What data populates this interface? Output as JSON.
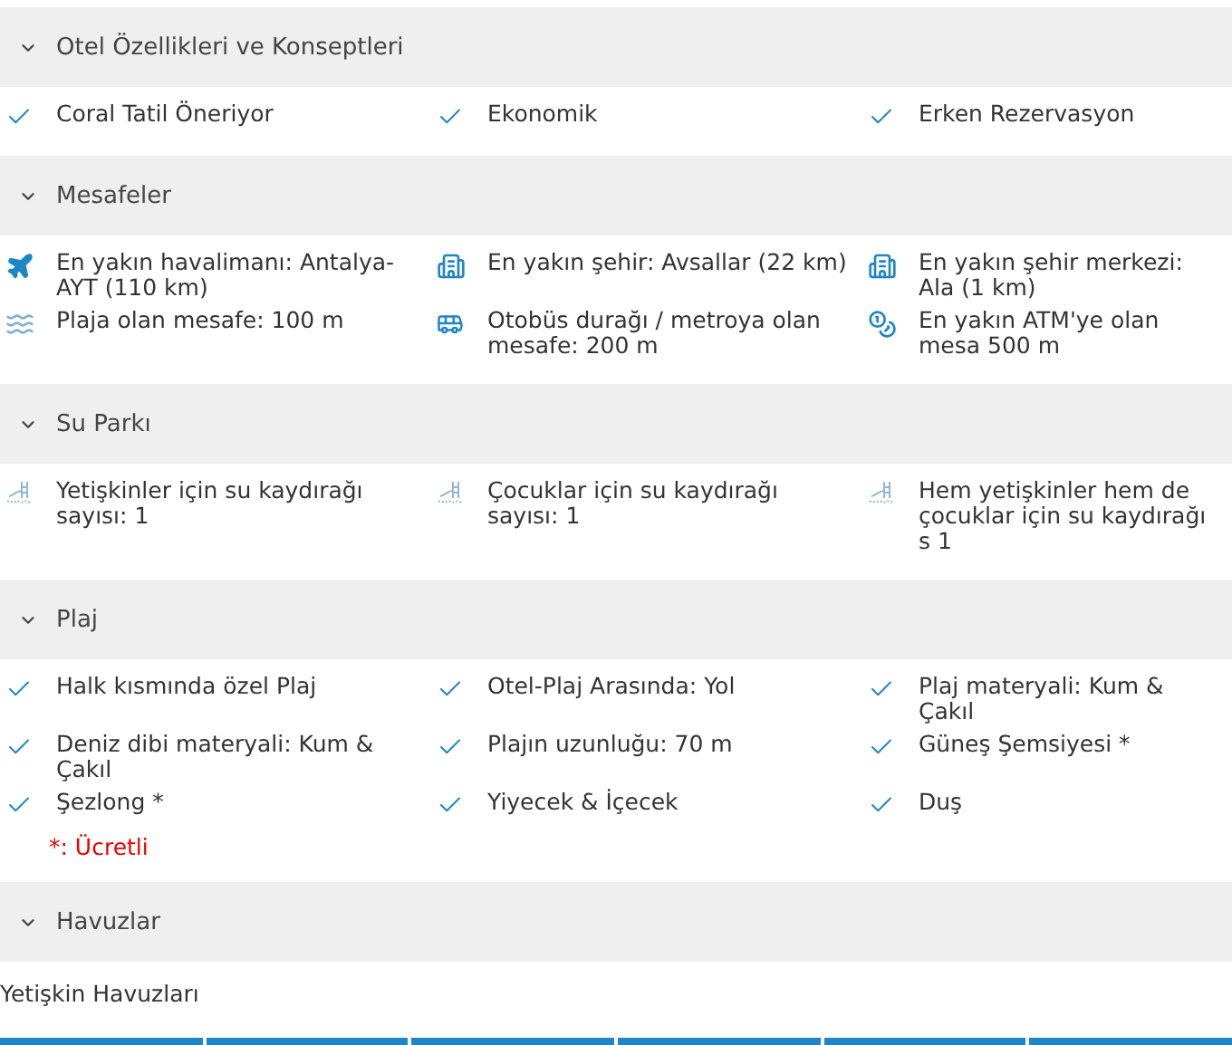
{
  "sections": [
    {
      "title": "Otel Özellikleri ve Konseptleri",
      "expanded": true,
      "items": [
        {
          "kind": "check",
          "text": "Coral Tatil Öneriyor"
        },
        {
          "kind": "check",
          "text": "Ekonomik"
        },
        {
          "kind": "check",
          "text": "Erken Rezervasyon"
        }
      ]
    },
    {
      "title": "Mesafeler",
      "expanded": true,
      "items": [
        {
          "kind": "plane",
          "text": "En yakın havalimanı: Antalya-AYT (110 km)"
        },
        {
          "kind": "city",
          "text": "En yakın şehir: Avsallar (22 km)"
        },
        {
          "kind": "city",
          "text": "En yakın şehir merkezi: Ala (1 km)"
        },
        {
          "kind": "beach",
          "text": "Plaja olan mesafe: 100 m"
        },
        {
          "kind": "bus",
          "text": "Otobüs durağı / metroya olan mesafe: 200 m"
        },
        {
          "kind": "atm",
          "text": "En yakın ATM'ye olan mesa 500 m"
        }
      ]
    },
    {
      "title": "Su Parkı",
      "expanded": true,
      "items": [
        {
          "kind": "slide",
          "text": "Yetişkinler için su kaydırağı sayısı: 1"
        },
        {
          "kind": "slide",
          "text": "Çocuklar için su kaydırağı sayısı: 1"
        },
        {
          "kind": "slide",
          "text": "Hem yetişkinler hem de çocuklar için su kaydırağı s 1"
        }
      ]
    },
    {
      "title": "Plaj",
      "expanded": true,
      "items": [
        {
          "kind": "check",
          "text": "Halk kısmında özel Plaj"
        },
        {
          "kind": "check",
          "text": "Otel-Plaj Arasında: Yol"
        },
        {
          "kind": "check",
          "text": "Plaj materyali: Kum & Çakıl"
        },
        {
          "kind": "check",
          "text": "Deniz dibi materyali: Kum & Çakıl"
        },
        {
          "kind": "check",
          "text": "Plajın uzunluğu: 70 m"
        },
        {
          "kind": "check",
          "text": "Güneş Şemsiyesi *"
        },
        {
          "kind": "check",
          "text": "Şezlong *"
        },
        {
          "kind": "check",
          "text": "Yiyecek & İçecek"
        },
        {
          "kind": "check",
          "text": "Duş"
        }
      ],
      "note": "*: Ücretli"
    },
    {
      "title": "Havuzlar",
      "expanded": true,
      "subheading": "Yetişkin Havuzları"
    }
  ]
}
